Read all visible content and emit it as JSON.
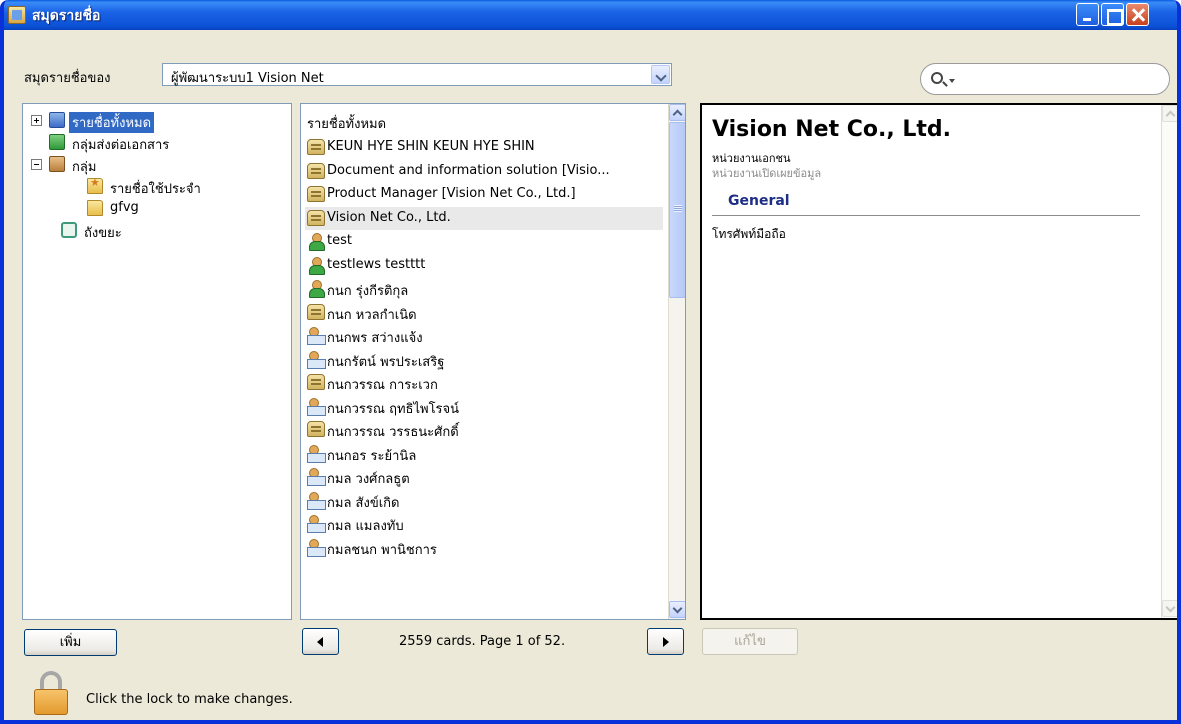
{
  "window": {
    "title": "สมุดรายชื่อ"
  },
  "owner": {
    "label": "สมุดรายชื่อของ",
    "selected": "ผู้พัฒนาระบบ1 Vision Net"
  },
  "search": {
    "placeholder": ""
  },
  "tree": {
    "items": [
      {
        "label": "รายชื่อทั้งหมด",
        "icon": "address-book-icon",
        "selected": true,
        "expander": "plus"
      },
      {
        "label": "กลุ่มส่งต่อเอกสาร",
        "icon": "forward-group-icon"
      },
      {
        "label": "กลุ่ม",
        "icon": "groups-icon",
        "expander": "minus"
      },
      {
        "label": "รายชื่อใช้ประจำ",
        "icon": "favorites-folder-icon"
      },
      {
        "label": "gfvg",
        "icon": "folder-icon"
      },
      {
        "label": "ถังขยะ",
        "icon": "trash-icon"
      }
    ]
  },
  "list": {
    "header": "รายชื่อทั้งหมด",
    "rows": [
      {
        "name": "KEUN HYE SHIN KEUN HYE SHIN",
        "icon": "company"
      },
      {
        "name": "Document and information solution [Visio...",
        "icon": "company"
      },
      {
        "name": "Product Manager [Vision Net Co., Ltd.]",
        "icon": "company"
      },
      {
        "name": "Vision Net Co., Ltd.",
        "icon": "company",
        "selected": true
      },
      {
        "name": "test",
        "icon": "person"
      },
      {
        "name": "testlews testttt",
        "icon": "person"
      },
      {
        "name": "กนก รุ่งกีรติกุล",
        "icon": "person"
      },
      {
        "name": "กนก หวลกำเนิด",
        "icon": "company"
      },
      {
        "name": "กนกพร สว่างแจ้ง",
        "icon": "person-card"
      },
      {
        "name": "กนกรัตน์ พรประเสริฐ",
        "icon": "person-card"
      },
      {
        "name": "กนกวรรณ การะเวก",
        "icon": "company"
      },
      {
        "name": "กนกวรรณ ฤทธิไพโรจน์",
        "icon": "person-card"
      },
      {
        "name": "กนกวรรณ วรรธนะศักดิ์",
        "icon": "company"
      },
      {
        "name": "กนกอร ระย้านิล",
        "icon": "person-card"
      },
      {
        "name": "กมล วงศ์กลธูต",
        "icon": "person-card"
      },
      {
        "name": "กมล สังข์เกิด",
        "icon": "person-card"
      },
      {
        "name": "กมล แมลงทับ",
        "icon": "person-card"
      },
      {
        "name": "กมลชนก พานิชการ",
        "icon": "person-card"
      }
    ]
  },
  "detail": {
    "name": "Vision Net Co., Ltd.",
    "org_type": "หน่วยงานเอกชน",
    "visibility": "หน่วยงานเปิดเผยข้อมูล",
    "section": "General",
    "field": "โทรศัพท์มือถือ"
  },
  "footer": {
    "add_label": "เพิ่ม",
    "page_info": "2559 cards. Page 1 of 52.",
    "edit_label": "แก้ไข",
    "lock_text": "Click the lock to make changes."
  }
}
